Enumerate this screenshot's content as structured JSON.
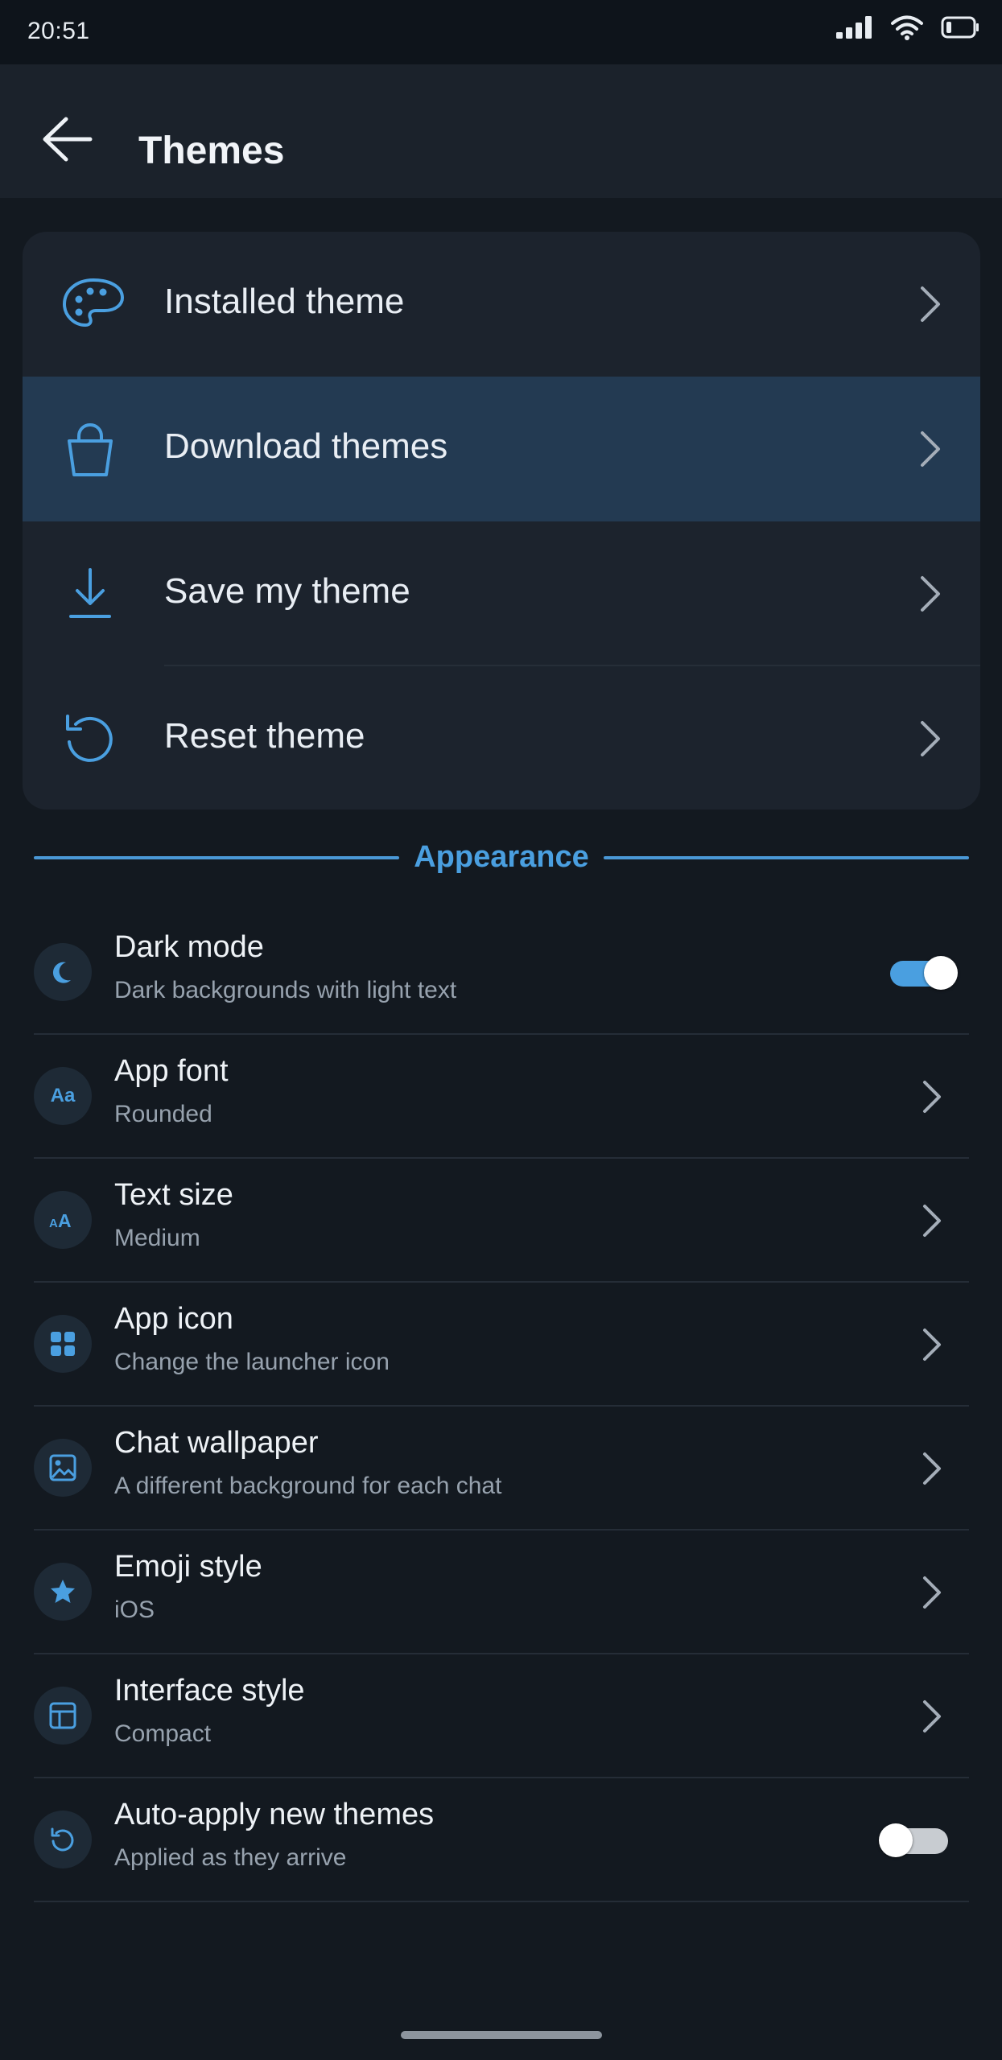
{
  "status_bar": {
    "time": "20:51"
  },
  "app_bar": {
    "title": "Themes"
  },
  "theme_menu": {
    "items": [
      {
        "label": "Installed theme",
        "icon": "palette-icon"
      },
      {
        "label": "Download themes",
        "icon": "shopping-bag-icon",
        "selected": true
      },
      {
        "label": "Save my theme",
        "icon": "download-icon"
      },
      {
        "label": "Reset theme",
        "icon": "reset-icon"
      }
    ]
  },
  "section": {
    "title": "Appearance"
  },
  "settings": [
    {
      "name": "Dark mode",
      "subtitle": "Dark backgrounds with light text",
      "control": "toggle",
      "toggle_on": true,
      "icon": "moon-icon"
    },
    {
      "name": "App font",
      "subtitle": "Rounded",
      "control": "chevron",
      "icon": "font-icon",
      "icon_text": "Aa"
    },
    {
      "name": "Text size",
      "subtitle": "Medium",
      "control": "chevron",
      "icon": "text-size-icon",
      "icon_text": "AA"
    },
    {
      "name": "App icon",
      "subtitle": "Change the launcher icon",
      "control": "chevron",
      "icon": "grid-icon"
    },
    {
      "name": "Chat wallpaper",
      "subtitle": "A different background for each chat",
      "control": "chevron",
      "icon": "image-icon"
    },
    {
      "name": "Emoji style",
      "subtitle": "iOS",
      "control": "chevron",
      "icon": "star-icon"
    },
    {
      "name": "Interface style",
      "subtitle": "Compact",
      "control": "chevron",
      "icon": "layout-icon"
    },
    {
      "name": "Auto-apply new themes",
      "subtitle": "Applied as they arrive",
      "control": "toggle",
      "toggle_on": false,
      "icon": "refresh-icon"
    }
  ],
  "colors": {
    "accent": "#4a9fe0",
    "background": "#131920",
    "card": "#1c232d",
    "selected_row": "#233a52"
  }
}
